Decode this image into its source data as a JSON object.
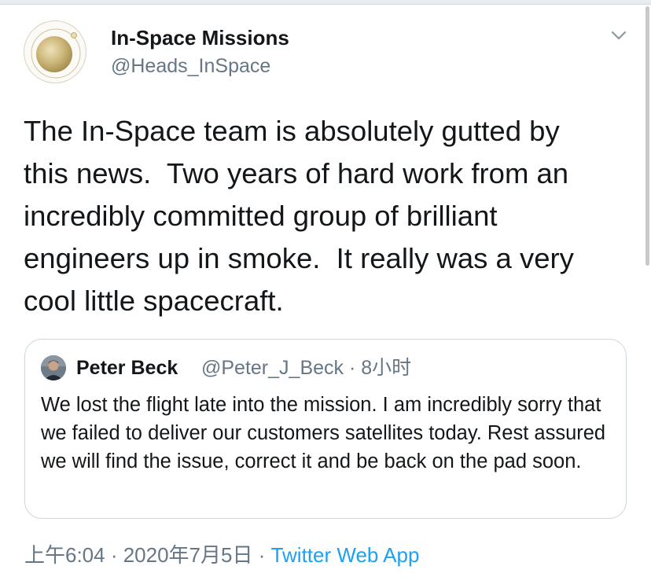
{
  "tweet": {
    "author": {
      "display_name": "In-Space Missions",
      "handle": "@Heads_InSpace",
      "avatar": "gold-circle-logo"
    },
    "menu_icon": "chevron-down-icon",
    "text": "The In-Space team is absolutely gutted by\nthis news.  Two years of hard work from an\nincredibly committed group of brilliant\nengineers up in smoke.  It really was a very\ncool little spacecraft.",
    "quoted": {
      "display_name": "Peter Beck",
      "meta": "@Peter_J_Beck · 8小时",
      "text": "We lost the flight late into the mission. I am incredibly sorry that we failed to deliver our customers satellites today. Rest assured we will find the issue, correct it and be back on the pad soon."
    },
    "timestamp": "上午6:04 · 2020年7月5日 · ",
    "source": "Twitter Web App"
  },
  "colors": {
    "text": "#14171a",
    "secondary": "#657786",
    "link": "#1da1f2",
    "border": "#ccd6dd"
  }
}
